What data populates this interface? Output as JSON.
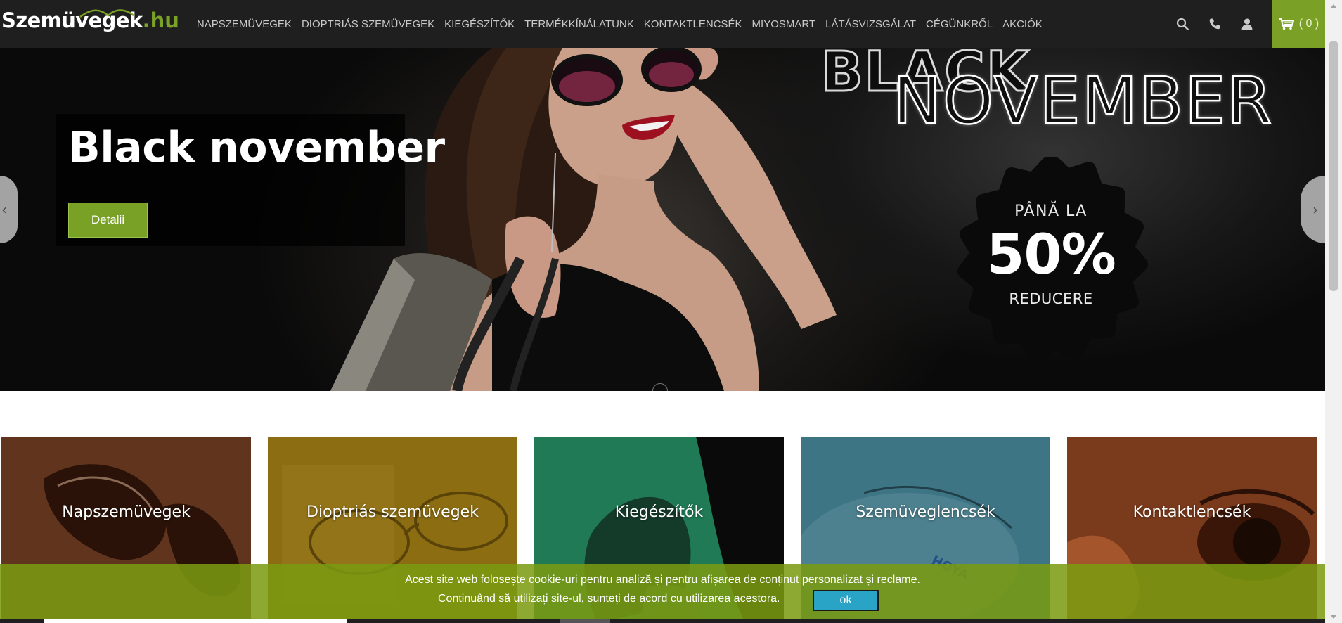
{
  "header": {
    "logo_main": "Szemüvegek",
    "logo_tld": ".hu",
    "nav": [
      "NAPSZEMÜVEGEK",
      "DIOPTRIÁS SZEMÜVEGEK",
      "KIEGÉSZÍTŐK",
      "TERMÉKKÍNÁLATUNK",
      "KONTAKTLENCSÉK",
      "MIYOSMART",
      "LÁTÁSVIZSGÁLAT",
      "CÉGÜNKRŐL",
      "AKCIÓK"
    ],
    "tools": {
      "search_icon": "search-icon",
      "phone_icon": "phone-icon",
      "user_icon": "user-icon"
    },
    "cart_count": "( 0 )",
    "cart_icon": "cart-icon"
  },
  "hero": {
    "title": "Black november",
    "button": "Detalii",
    "banner_top": "BLACK",
    "banner_main": "NOVEMBER",
    "badge_top": "PÂNĂ LA",
    "badge_big": "50%",
    "badge_bottom": "REDUCERE",
    "prev_glyph": "‹",
    "next_glyph": "›"
  },
  "categories": [
    {
      "label": "Napszemüvegek",
      "color": "#6b3a20"
    },
    {
      "label": "Dioptriás szemüvegek",
      "color": "#8a6a14"
    },
    {
      "label": "Kiegészítők",
      "color": "#1f7a55"
    },
    {
      "label": "Szemüveglencsék",
      "color": "#3d7585"
    },
    {
      "label": "Kontaktlencsék",
      "color": "#7a3a1c"
    }
  ],
  "cookie": {
    "line1": "Acest site web folosește cookie-uri pentru analiză și pentru afișarea de conținut personalizat și reclame.",
    "line2": "Continuând să utilizați site-ul, sunteți de acord cu utilizarea acestora.",
    "ok": "ok"
  },
  "colors": {
    "brand_green": "#79a125",
    "nav_bg": "#1f1f1f",
    "cookie_bg": "#7a9b10",
    "ok_button": "#29a3c6"
  }
}
